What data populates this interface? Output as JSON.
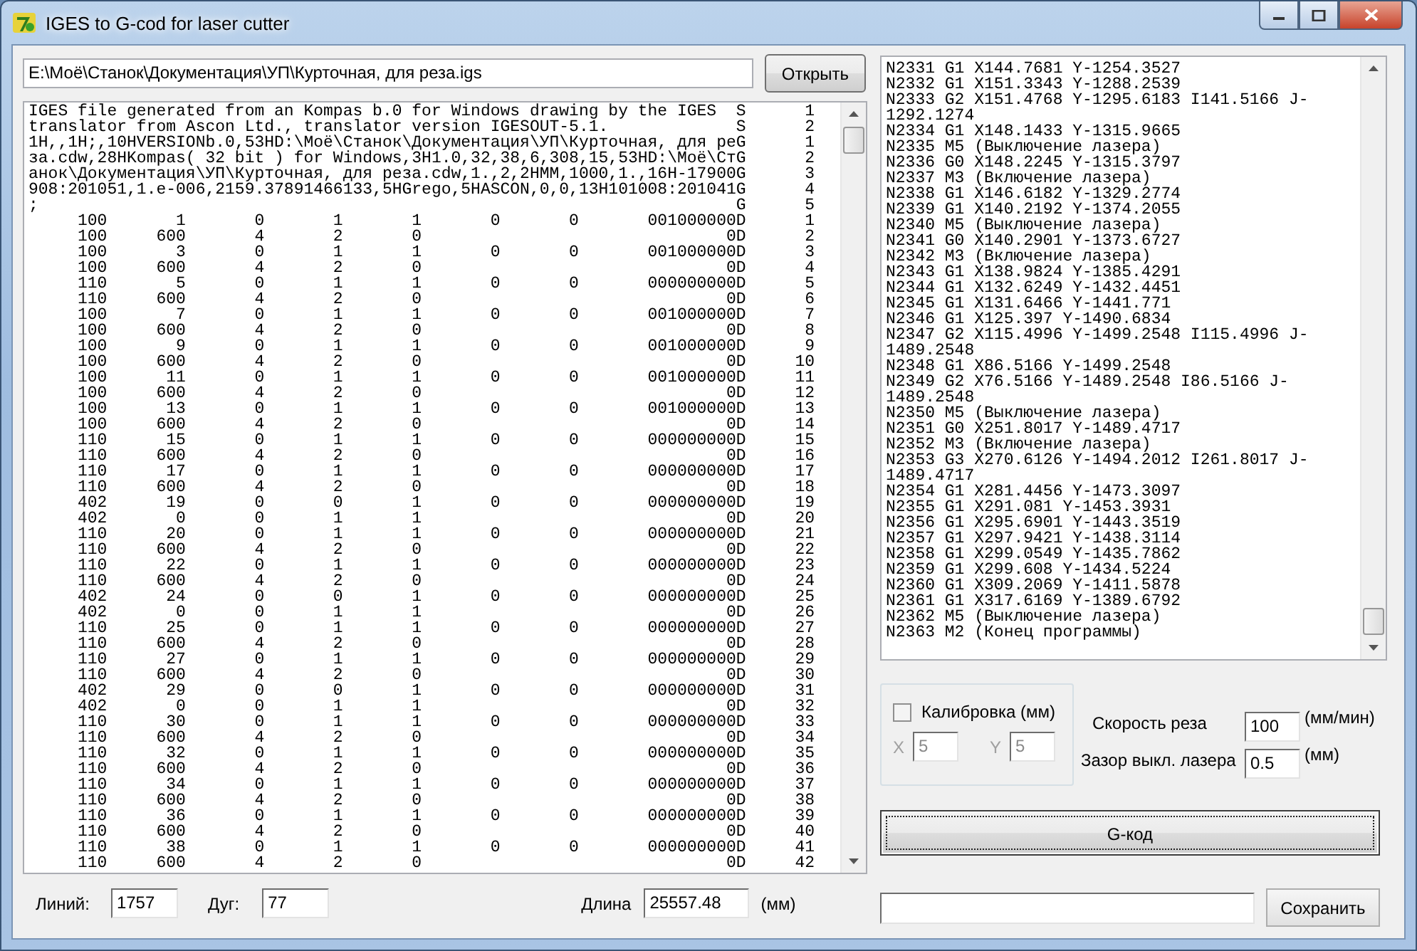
{
  "window": {
    "title": "IGES to G-cod for laser cutter"
  },
  "file": {
    "path": "E:\\Моё\\Станок\\Документация\\УП\\Курточная, для реза.igs",
    "button": "Открыть"
  },
  "iges_text": {
    "header": [
      {
        "text": "IGES file generated from an Kompas b.0 for Windows drawing by the IGES",
        "section": "S",
        "seq": "1"
      },
      {
        "text": "translator from Ascon Ltd., translator version IGESOUT-5.1.",
        "section": "S",
        "seq": "2"
      },
      {
        "text": "1H,,1H;,10HVERSIONb.0,53HD:\\Моё\\Станок\\Документация\\УП\\Курточная, для ре",
        "section": "G",
        "seq": "1"
      },
      {
        "text": "за.cdw,28HKompas( 32 bit ) for Windows,3H1.0,32,38,6,308,15,53HD:\\Моё\\Ст",
        "section": "G",
        "seq": "2"
      },
      {
        "text": "анок\\Документация\\УП\\Курточная, для реза.cdw,1.,2,2HMM,1000,1.,16H-17900",
        "section": "G",
        "seq": "3"
      },
      {
        "text": "908:201051,1.e-006,2159.37891466133,5HGrego,5HASCON,0,0,13H101008:201041",
        "section": "G",
        "seq": "4"
      },
      {
        "text": ";",
        "section": "G",
        "seq": "5"
      }
    ],
    "rows": [
      {
        "cells": [
          "100",
          "1",
          "0",
          "1",
          "1",
          "0",
          "0"
        ],
        "code": "001000000D",
        "seq": "1"
      },
      {
        "cells": [
          "100",
          "600",
          "4",
          "2",
          "0"
        ],
        "code": "0D",
        "seq": "2"
      },
      {
        "cells": [
          "100",
          "3",
          "0",
          "1",
          "1",
          "0",
          "0"
        ],
        "code": "001000000D",
        "seq": "3"
      },
      {
        "cells": [
          "100",
          "600",
          "4",
          "2",
          "0"
        ],
        "code": "0D",
        "seq": "4"
      },
      {
        "cells": [
          "110",
          "5",
          "0",
          "1",
          "1",
          "0",
          "0"
        ],
        "code": "000000000D",
        "seq": "5"
      },
      {
        "cells": [
          "110",
          "600",
          "4",
          "2",
          "0"
        ],
        "code": "0D",
        "seq": "6"
      },
      {
        "cells": [
          "100",
          "7",
          "0",
          "1",
          "1",
          "0",
          "0"
        ],
        "code": "001000000D",
        "seq": "7"
      },
      {
        "cells": [
          "100",
          "600",
          "4",
          "2",
          "0"
        ],
        "code": "0D",
        "seq": "8"
      },
      {
        "cells": [
          "100",
          "9",
          "0",
          "1",
          "1",
          "0",
          "0"
        ],
        "code": "001000000D",
        "seq": "9"
      },
      {
        "cells": [
          "100",
          "600",
          "4",
          "2",
          "0"
        ],
        "code": "0D",
        "seq": "10"
      },
      {
        "cells": [
          "100",
          "11",
          "0",
          "1",
          "1",
          "0",
          "0"
        ],
        "code": "001000000D",
        "seq": "11"
      },
      {
        "cells": [
          "100",
          "600",
          "4",
          "2",
          "0"
        ],
        "code": "0D",
        "seq": "12"
      },
      {
        "cells": [
          "100",
          "13",
          "0",
          "1",
          "1",
          "0",
          "0"
        ],
        "code": "001000000D",
        "seq": "13"
      },
      {
        "cells": [
          "100",
          "600",
          "4",
          "2",
          "0"
        ],
        "code": "0D",
        "seq": "14"
      },
      {
        "cells": [
          "110",
          "15",
          "0",
          "1",
          "1",
          "0",
          "0"
        ],
        "code": "000000000D",
        "seq": "15"
      },
      {
        "cells": [
          "110",
          "600",
          "4",
          "2",
          "0"
        ],
        "code": "0D",
        "seq": "16"
      },
      {
        "cells": [
          "110",
          "17",
          "0",
          "1",
          "1",
          "0",
          "0"
        ],
        "code": "000000000D",
        "seq": "17"
      },
      {
        "cells": [
          "110",
          "600",
          "4",
          "2",
          "0"
        ],
        "code": "0D",
        "seq": "18"
      },
      {
        "cells": [
          "402",
          "19",
          "0",
          "0",
          "1",
          "0",
          "0"
        ],
        "code": "000000000D",
        "seq": "19"
      },
      {
        "cells": [
          "402",
          "0",
          "0",
          "1",
          "1"
        ],
        "code": "0D",
        "seq": "20"
      },
      {
        "cells": [
          "110",
          "20",
          "0",
          "1",
          "1",
          "0",
          "0"
        ],
        "code": "000000000D",
        "seq": "21"
      },
      {
        "cells": [
          "110",
          "600",
          "4",
          "2",
          "0"
        ],
        "code": "0D",
        "seq": "22"
      },
      {
        "cells": [
          "110",
          "22",
          "0",
          "1",
          "1",
          "0",
          "0"
        ],
        "code": "000000000D",
        "seq": "23"
      },
      {
        "cells": [
          "110",
          "600",
          "4",
          "2",
          "0"
        ],
        "code": "0D",
        "seq": "24"
      },
      {
        "cells": [
          "402",
          "24",
          "0",
          "0",
          "1",
          "0",
          "0"
        ],
        "code": "000000000D",
        "seq": "25"
      },
      {
        "cells": [
          "402",
          "0",
          "0",
          "1",
          "1"
        ],
        "code": "0D",
        "seq": "26"
      },
      {
        "cells": [
          "110",
          "25",
          "0",
          "1",
          "1",
          "0",
          "0"
        ],
        "code": "000000000D",
        "seq": "27"
      },
      {
        "cells": [
          "110",
          "600",
          "4",
          "2",
          "0"
        ],
        "code": "0D",
        "seq": "28"
      },
      {
        "cells": [
          "110",
          "27",
          "0",
          "1",
          "1",
          "0",
          "0"
        ],
        "code": "000000000D",
        "seq": "29"
      },
      {
        "cells": [
          "110",
          "600",
          "4",
          "2",
          "0"
        ],
        "code": "0D",
        "seq": "30"
      },
      {
        "cells": [
          "402",
          "29",
          "0",
          "0",
          "1",
          "0",
          "0"
        ],
        "code": "000000000D",
        "seq": "31"
      },
      {
        "cells": [
          "402",
          "0",
          "0",
          "1",
          "1"
        ],
        "code": "0D",
        "seq": "32"
      },
      {
        "cells": [
          "110",
          "30",
          "0",
          "1",
          "1",
          "0",
          "0"
        ],
        "code": "000000000D",
        "seq": "33"
      },
      {
        "cells": [
          "110",
          "600",
          "4",
          "2",
          "0"
        ],
        "code": "0D",
        "seq": "34"
      },
      {
        "cells": [
          "110",
          "32",
          "0",
          "1",
          "1",
          "0",
          "0"
        ],
        "code": "000000000D",
        "seq": "35"
      },
      {
        "cells": [
          "110",
          "600",
          "4",
          "2",
          "0"
        ],
        "code": "0D",
        "seq": "36"
      },
      {
        "cells": [
          "110",
          "34",
          "0",
          "1",
          "1",
          "0",
          "0"
        ],
        "code": "000000000D",
        "seq": "37"
      },
      {
        "cells": [
          "110",
          "600",
          "4",
          "2",
          "0"
        ],
        "code": "0D",
        "seq": "38"
      },
      {
        "cells": [
          "110",
          "36",
          "0",
          "1",
          "1",
          "0",
          "0"
        ],
        "code": "000000000D",
        "seq": "39"
      },
      {
        "cells": [
          "110",
          "600",
          "4",
          "2",
          "0"
        ],
        "code": "0D",
        "seq": "40"
      },
      {
        "cells": [
          "110",
          "38",
          "0",
          "1",
          "1",
          "0",
          "0"
        ],
        "code": "000000000D",
        "seq": "41"
      },
      {
        "cells": [
          "110",
          "600",
          "4",
          "2",
          "0"
        ],
        "code": "0D",
        "seq": "42"
      }
    ]
  },
  "stats": [
    {
      "label": "Линий:",
      "value": "1757"
    },
    {
      "label": "Дуг:",
      "value": "77"
    },
    {
      "label": "Длина",
      "value": "25557.48",
      "unit": "(мм)"
    }
  ],
  "gcode_lines": [
    "N2331 G1 X144.7681 Y-1254.3527",
    "N2332 G1 X151.3343 Y-1288.2539",
    "N2333 G2 X151.4768 Y-1295.6183 I141.5166 J-",
    "1292.1274",
    "N2334 G1 X148.1433 Y-1315.9665",
    "N2335 M5 (Выключение лазера)",
    "N2336 G0 X148.2245 Y-1315.3797",
    "N2337 M3 (Включение лазера)",
    "N2338 G1 X146.6182 Y-1329.2774",
    "N2339 G1 X140.2192 Y-1374.2055",
    "N2340 M5 (Выключение лазера)",
    "N2341 G0 X140.2901 Y-1373.6727",
    "N2342 M3 (Включение лазера)",
    "N2343 G1 X138.9824 Y-1385.4291",
    "N2344 G1 X132.6249 Y-1432.4451",
    "N2345 G1 X131.6466 Y-1441.771",
    "N2346 G1 X125.397 Y-1490.6834",
    "N2347 G2 X115.4996 Y-1499.2548 I115.4996 J-",
    "1489.2548",
    "N2348 G1 X86.5166 Y-1499.2548",
    "N2349 G2 X76.5166 Y-1489.2548 I86.5166 J-",
    "1489.2548",
    "N2350 M5 (Выключение лазера)",
    "N2351 G0 X251.8017 Y-1489.4717",
    "N2352 M3 (Включение лазера)",
    "N2353 G3 X270.6126 Y-1494.2012 I261.8017 J-",
    "1489.4717",
    "N2354 G1 X281.4456 Y-1473.3097",
    "N2355 G1 X291.081 Y-1453.3931",
    "N2356 G1 X295.6901 Y-1443.3519",
    "N2357 G1 X297.9421 Y-1438.3114",
    "N2358 G1 X299.0549 Y-1435.7862",
    "N2359 G1 X299.608 Y-1434.5224",
    "N2360 G1 X309.2069 Y-1411.5878",
    "N2361 G1 X317.6169 Y-1389.6792",
    "N2362 M5 (Выключение лазера)",
    "N2363 M2 (Конец программы)"
  ],
  "calibration": {
    "label": "Калибровка (мм)",
    "checked": false,
    "fields": [
      {
        "label": "X",
        "value": "5",
        "disabled": true
      },
      {
        "label": "Y",
        "value": "5",
        "disabled": true
      }
    ]
  },
  "params": [
    {
      "label": "Скорость реза",
      "value": "100",
      "unit": "(мм/мин)"
    },
    {
      "label": "Зазор выкл. лазера",
      "value": "0.5",
      "unit": "(мм)"
    }
  ],
  "generate_button": "G-код",
  "save": {
    "button": "Сохранить"
  }
}
